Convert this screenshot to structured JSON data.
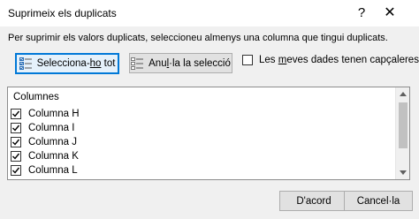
{
  "window": {
    "title": "Suprimeix els duplicats",
    "help_glyph": "?",
    "close_glyph": "✕"
  },
  "instruction": "Per suprimir els valors duplicats, seleccioneu almenys una columna que tingui duplicats.",
  "toolbar": {
    "select_all": {
      "pre": "Selecciona-",
      "underlined": "ho",
      "post": " tot",
      "icon": "select-all-icon"
    },
    "unselect_all": {
      "pre": "Anu",
      "underlined": "l",
      "post": "·la la selecció",
      "icon": "unselect-all-icon"
    },
    "headers_checkbox": {
      "pre": "Les ",
      "underlined": "m",
      "post": "eves dades tenen capçaleres",
      "checked": false
    }
  },
  "columns_list": {
    "header": "Columnes",
    "items": [
      {
        "label": "Columna H",
        "checked": true
      },
      {
        "label": "Columna I",
        "checked": true
      },
      {
        "label": "Columna J",
        "checked": true
      },
      {
        "label": "Columna K",
        "checked": true
      },
      {
        "label": "Columna L",
        "checked": true
      }
    ]
  },
  "footer": {
    "ok": "D'acord",
    "cancel": "Cancel·la"
  },
  "colors": {
    "focus_border": "#0078d7",
    "dialog_bg": "#f0f0f0"
  }
}
